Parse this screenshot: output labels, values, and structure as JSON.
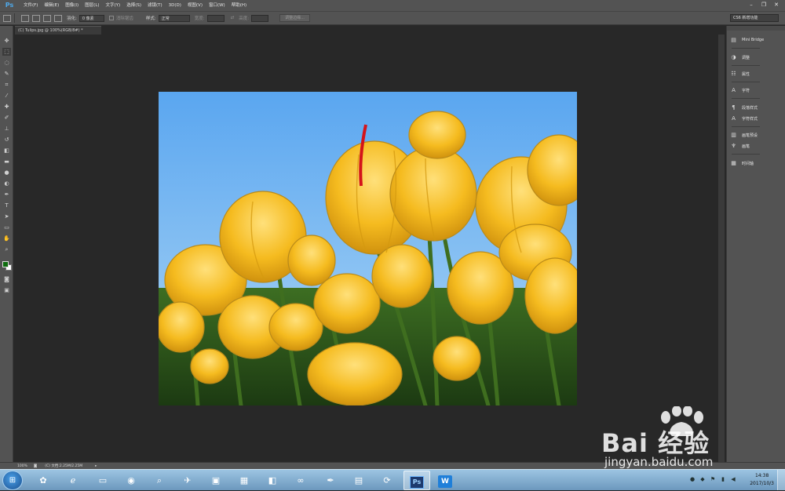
{
  "menubar": {
    "logo": "Ps",
    "items": [
      "文件(F)",
      "编辑(E)",
      "图像(I)",
      "图层(L)",
      "文字(Y)",
      "选择(S)",
      "滤镜(T)",
      "3D(D)",
      "视图(V)",
      "窗口(W)",
      "帮助(H)"
    ],
    "window_controls": [
      "–",
      "❐",
      "✕"
    ]
  },
  "optionsbar": {
    "feather_label": "羽化:",
    "feather_value": "0 像素",
    "antialias_label": "消除锯齿",
    "style_label": "样式:",
    "style_value": "正常",
    "width_label": "宽度:",
    "height_label": "高度:",
    "refine_edge_button": "调整边缘...",
    "workspace": "CS6 新增功能"
  },
  "document": {
    "tab_title": "(C) Tulips.jpg @ 100%(RGB/8#) *"
  },
  "panels": [
    {
      "label": "Mini Bridge",
      "icon": "mini-bridge-icon"
    },
    {
      "label": "调整",
      "icon": "adjustments-icon"
    },
    {
      "label": "属性",
      "icon": "properties-icon"
    },
    {
      "label": "字符",
      "icon": "character-icon"
    },
    {
      "label": "段落样式",
      "icon": "paragraph-styles-icon"
    },
    {
      "label": "字符样式",
      "icon": "character-styles-icon"
    },
    {
      "label": "画笔预设",
      "icon": "brush-presets-icon"
    },
    {
      "label": "画笔",
      "icon": "brush-icon"
    },
    {
      "label": "时间轴",
      "icon": "timeline-icon"
    }
  ],
  "statusbar": {
    "zoom": "100%",
    "doc_size": "(C) 文档:2.25M/2.25M"
  },
  "taskbar": {
    "time": "14:38",
    "date": "2017/10/3",
    "active_app": "Ps",
    "active_color": "#1d3a6e"
  },
  "watermark": {
    "brand": "Bai 经验",
    "url": "jingyan.baidu.com"
  },
  "colors": {
    "foreground": "#0e6b0e",
    "background": "#ffffff"
  }
}
